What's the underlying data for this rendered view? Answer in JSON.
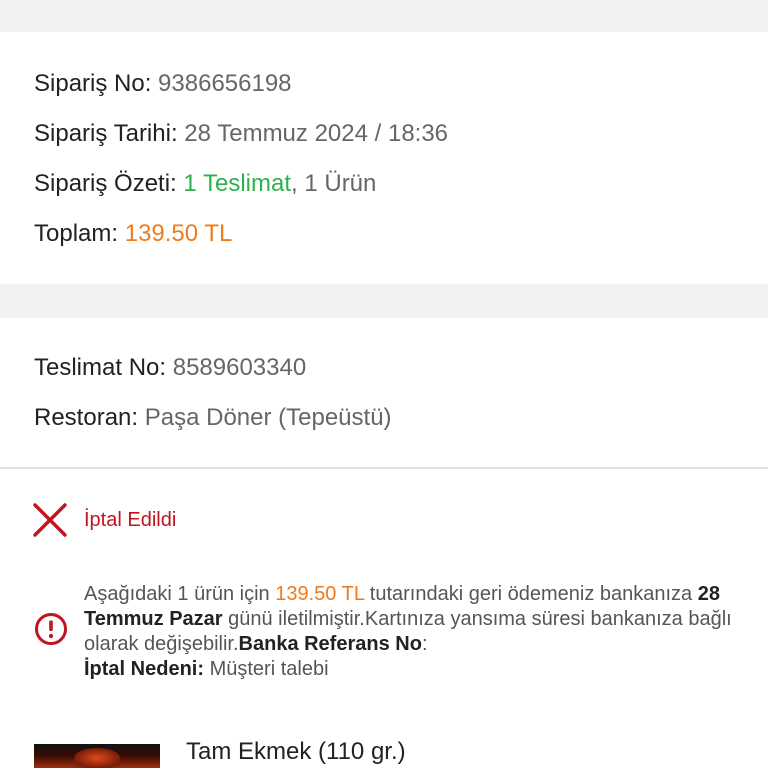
{
  "order": {
    "number_label": "Sipariş No:",
    "number_value": "9386656198",
    "date_label": "Sipariş Tarihi:",
    "date_value": "28 Temmuz 2024 / 18:36",
    "summary_label": "Sipariş Özeti:",
    "summary_delivery": "1 Teslimat",
    "summary_sep": ",",
    "summary_items": "1 Ürün",
    "total_label": "Toplam:",
    "total_value": "139.50 TL"
  },
  "delivery": {
    "number_label": "Teslimat No:",
    "number_value": "8589603340",
    "restaurant_label": "Restoran:",
    "restaurant_value": "Paşa Döner (Tepeüstü)"
  },
  "status": {
    "icon": "close-x-icon",
    "text": "İptal Edildi",
    "color": "#c0141e"
  },
  "refund": {
    "icon": "info-circle-icon",
    "part1": "Aşağıdaki 1 ürün için ",
    "amount": "139.50 TL",
    "part2": " tutarındaki geri ödemeniz bankanıza ",
    "date_bold": "28 Temmuz Pazar",
    "part3": " günü iletilmiştir.Kartınıza yansıma süresi bankanıza bağlı olarak değişebilir.",
    "ref_label": "Banka Referans No",
    "ref_sep": ":",
    "reason_label": "İptal Nedeni:",
    "reason_value": " Müşteri talebi"
  },
  "product": {
    "name": "Tam Ekmek (110 gr.)"
  },
  "colors": {
    "accent_orange": "#f27a1a",
    "accent_green": "#2bb24c",
    "cancel_red": "#c0141e",
    "background_gray": "#f2f2f2"
  }
}
